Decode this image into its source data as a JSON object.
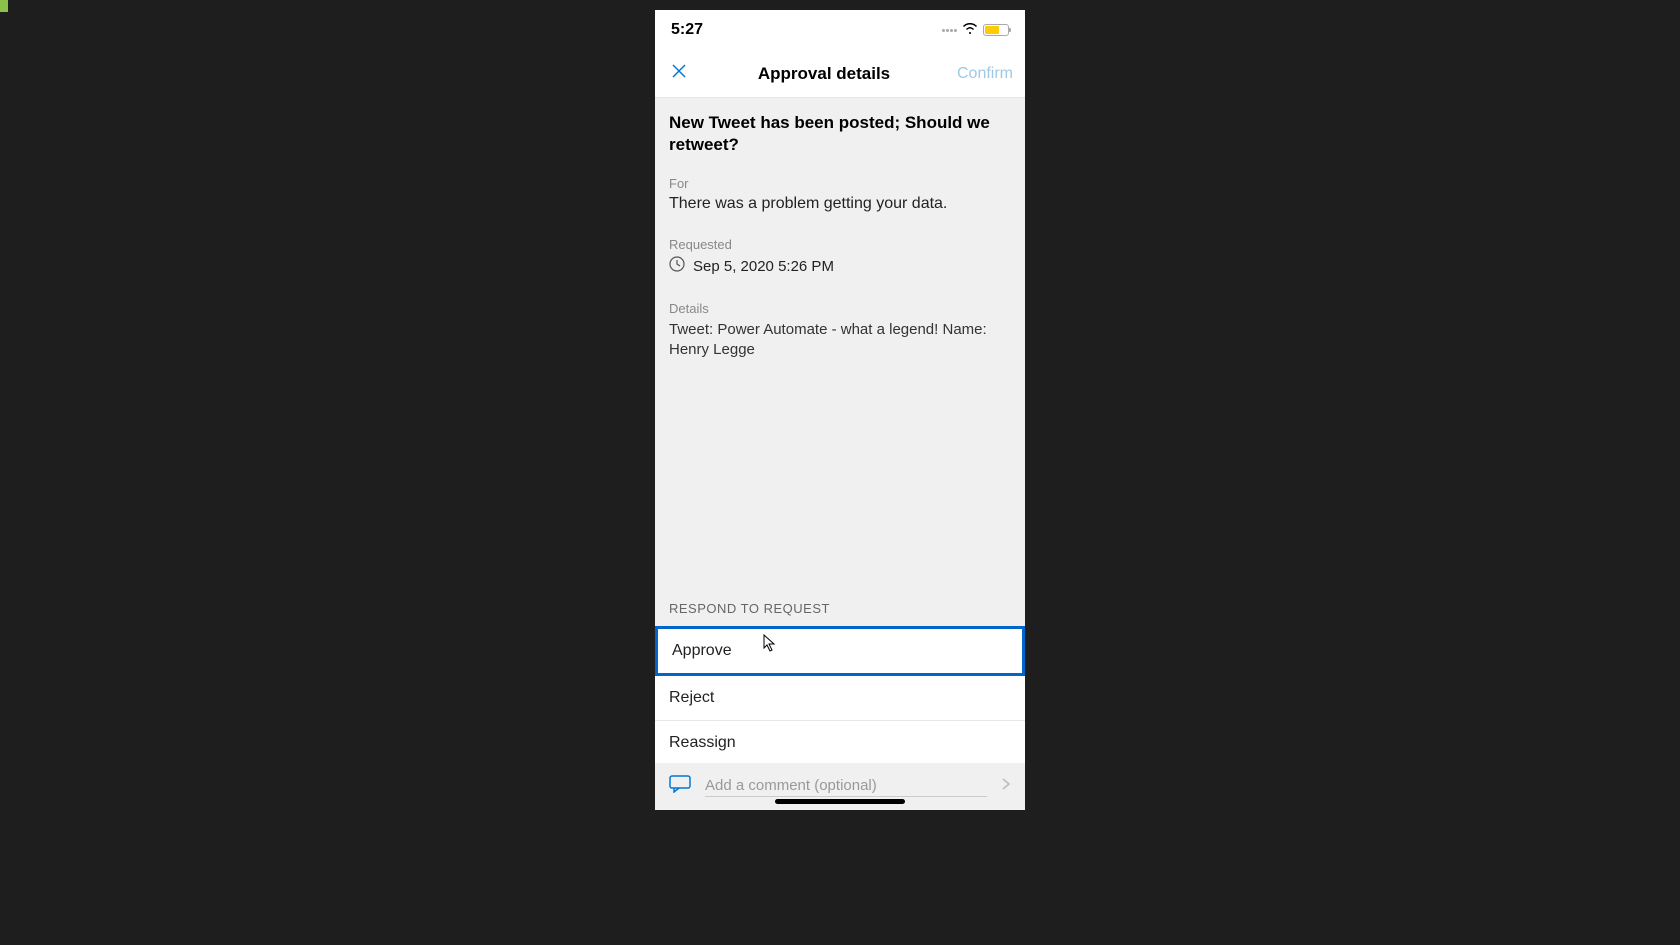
{
  "status": {
    "time": "5:27"
  },
  "nav": {
    "title": "Approval details",
    "confirm": "Confirm"
  },
  "approval": {
    "title": "New Tweet has been posted; Should we retweet?",
    "for_label": "For",
    "for_value": "There was a problem getting your data.",
    "requested_label": "Requested",
    "requested_value": "Sep 5, 2020 5:26 PM",
    "details_label": "Details",
    "details_value": "Tweet: Power Automate - what a legend! Name: Henry Legge"
  },
  "respond": {
    "header": "RESPOND TO REQUEST",
    "approve": "Approve",
    "reject": "Reject",
    "reassign": "Reassign"
  },
  "comment": {
    "placeholder": "Add a comment (optional)"
  }
}
